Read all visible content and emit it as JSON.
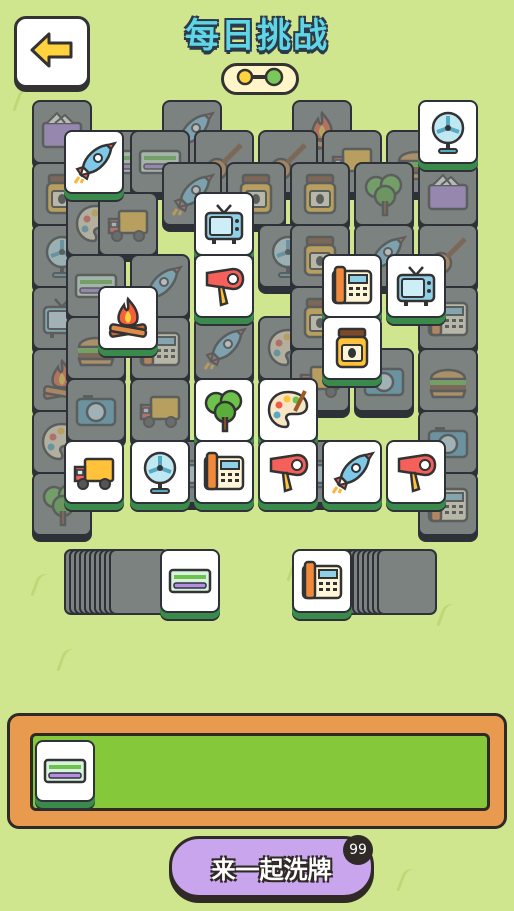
{
  "header": {
    "title": "每日挑战",
    "back_icon": "arrow-left-icon",
    "progress_icon": "key-progress-icon"
  },
  "colors": {
    "background": "#cfe68f",
    "tile_free": "#ffffff",
    "tile_covered": "#7c8280",
    "tray_frame": "#e89a4f",
    "tray_fill": "#85c83a",
    "shuffle_button": "#c9a5ee",
    "title_fill": "#5fd6e6"
  },
  "board": {
    "free_tiles": [
      "rocket",
      "fan",
      "tv",
      "hair-dryer",
      "campfire",
      "phone",
      "tv",
      "jar",
      "tree",
      "palette",
      "truck",
      "fan",
      "phone",
      "hair-dryer",
      "rocket",
      "hair-dryer"
    ]
  },
  "side_stacks": {
    "left_top_tile": "air-conditioner",
    "right_top_tile": "phone"
  },
  "tray": {
    "slots": [
      "air-conditioner"
    ],
    "capacity": 7
  },
  "shuffle": {
    "label": "来一起洗牌",
    "badge": "99"
  }
}
